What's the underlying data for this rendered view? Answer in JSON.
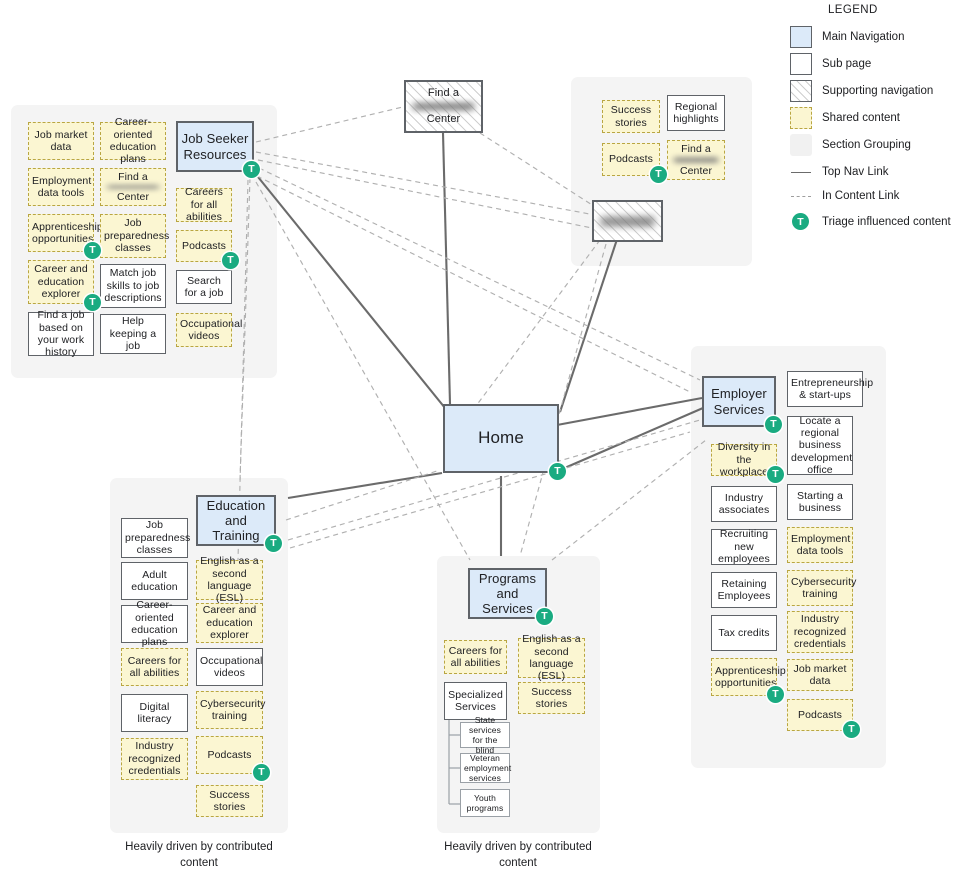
{
  "legend": {
    "title": "LEGEND",
    "items": [
      {
        "key": "main-navigation",
        "label": "Main Navigation",
        "swatch": "main",
        "color": "#dceaf9"
      },
      {
        "key": "sub-page",
        "label": "Sub page",
        "swatch": "sub",
        "color": "#ffffff"
      },
      {
        "key": "supporting-navigation",
        "label": "Supporting navigation",
        "swatch": "support",
        "color": "#ffffff"
      },
      {
        "key": "shared-content",
        "label": "Shared content",
        "swatch": "shared",
        "color": "#fbf6d2"
      },
      {
        "key": "section-grouping",
        "label": "Section Grouping",
        "swatch": "group",
        "color": "#f1f1f1"
      },
      {
        "key": "top-nav-link",
        "label": "Top Nav Link",
        "swatch": "line",
        "color": "#6b6b6b"
      },
      {
        "key": "in-content-link",
        "label": "In Content Link",
        "swatch": "dash",
        "color": "#9e9e9e"
      },
      {
        "key": "triage",
        "label": "Triage influenced content",
        "swatch": "badge",
        "color": "#1aab81"
      }
    ]
  },
  "badge_letter": "T",
  "home": {
    "label": "Home",
    "triage": true
  },
  "top_center": {
    "line1": "Find a",
    "redacted": "",
    "line2": "Center"
  },
  "job_seeker": {
    "title": "Job Seeker Resources",
    "items": [
      {
        "label": "Job market data",
        "type": "shared"
      },
      {
        "label": "Career-oriented education plans",
        "type": "shared"
      },
      {
        "label": "Careers for all abilities",
        "type": "shared"
      },
      {
        "label": "Employment data tools",
        "type": "shared"
      },
      {
        "label": "Find a   Center",
        "type": "shared",
        "redacted": true,
        "line1": "Find a",
        "line2": "Center"
      },
      {
        "label": "Podcasts",
        "type": "shared",
        "triage": true
      },
      {
        "label": "Apprenticeship opportunities",
        "type": "shared",
        "triage": true
      },
      {
        "label": "Job preparedness classes",
        "type": "shared"
      },
      {
        "label": "Search for a job",
        "type": "sub"
      },
      {
        "label": "Career and education explorer",
        "type": "shared",
        "triage": true
      },
      {
        "label": "Match job skills to job descriptions",
        "type": "sub"
      },
      {
        "label": "Occupational videos",
        "type": "shared"
      },
      {
        "label": "Find a job based on your work history",
        "type": "sub"
      },
      {
        "label": "Help keeping a job",
        "type": "sub"
      }
    ]
  },
  "top_right": {
    "items": [
      {
        "label": "Success stories",
        "type": "shared"
      },
      {
        "label": "Regional highlights",
        "type": "sub"
      },
      {
        "label": "Podcasts",
        "type": "shared",
        "triage": true
      },
      {
        "label": "Find a   Center",
        "type": "shared",
        "redacted": true,
        "line1": "Find a",
        "line2": "Center"
      }
    ],
    "support_node": {
      "label": "",
      "redacted": true,
      "type": "support"
    }
  },
  "education": {
    "title": "Education and Training",
    "triage": true,
    "items": [
      {
        "label": "Job preparedness classes",
        "type": "sub"
      },
      {
        "label": "Adult education",
        "type": "sub"
      },
      {
        "label": "English as a second language (ESL)",
        "type": "shared"
      },
      {
        "label": "Career-oriented education plans",
        "type": "sub"
      },
      {
        "label": "Career and education explorer",
        "type": "shared"
      },
      {
        "label": "Careers for all abilities",
        "type": "shared"
      },
      {
        "label": "Occupational videos",
        "type": "sub"
      },
      {
        "label": "Digital literacy",
        "type": "sub"
      },
      {
        "label": "Cybersecurity training",
        "type": "shared"
      },
      {
        "label": "Industry recognized credentials",
        "type": "shared"
      },
      {
        "label": "Podcasts",
        "type": "shared",
        "triage": true
      },
      {
        "label": "Success stories",
        "type": "shared"
      }
    ],
    "caption": "Heavily driven by contributed content"
  },
  "programs": {
    "title": "Programs and Services",
    "triage": true,
    "items": [
      {
        "label": "Careers for all abilities",
        "type": "shared"
      },
      {
        "label": "English as a second language (ESL)",
        "type": "shared"
      },
      {
        "label": "Specialized Services",
        "type": "sub"
      },
      {
        "label": "Success stories",
        "type": "shared"
      }
    ],
    "specialized_children": [
      {
        "label": "State services for the blind",
        "type": "sub-sm"
      },
      {
        "label": "Veteran employment services",
        "type": "sub-sm"
      },
      {
        "label": "Youth programs",
        "type": "sub-sm"
      }
    ],
    "caption": "Heavily driven by contributed content"
  },
  "employer": {
    "title": "Employer Services",
    "triage": true,
    "items": [
      {
        "label": "Entrepreneurship & start-ups",
        "type": "sub"
      },
      {
        "label": "Diversity in the workplace",
        "type": "shared",
        "triage": true
      },
      {
        "label": "Locate a regional business development office",
        "type": "sub"
      },
      {
        "label": "Industry associates",
        "type": "sub"
      },
      {
        "label": "Starting a business",
        "type": "sub"
      },
      {
        "label": "Recruiting new employees",
        "type": "sub"
      },
      {
        "label": "Employment data tools",
        "type": "shared"
      },
      {
        "label": "Retaining Employees",
        "type": "sub"
      },
      {
        "label": "Cybersecurity training",
        "type": "shared"
      },
      {
        "label": "Tax credits",
        "type": "sub"
      },
      {
        "label": "Industry recognized credentials",
        "type": "shared"
      },
      {
        "label": "Apprenticeship opportunities",
        "type": "shared",
        "triage": true
      },
      {
        "label": "Job market data",
        "type": "shared"
      },
      {
        "label": "Podcasts",
        "type": "shared",
        "triage": true
      }
    ]
  }
}
